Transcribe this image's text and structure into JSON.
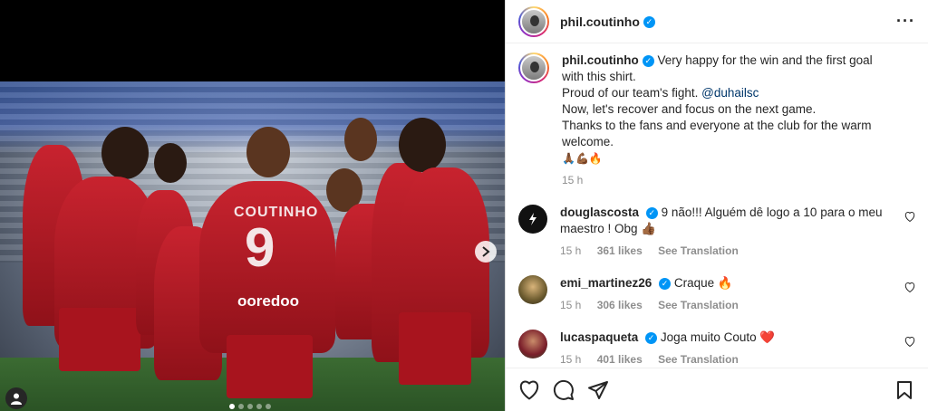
{
  "post": {
    "author": "phil.coutinho",
    "caption_lines": [
      "Very happy for the win and the first goal with this shirt.",
      "Proud of our team's fight.",
      "Now, let's recover and focus on the next game.",
      "Thanks to the fans and everyone at the club for the warm welcome."
    ],
    "mention": "@duhailsc",
    "emojis": "🙏🏾💪🏾🔥",
    "time": "15 h"
  },
  "photo": {
    "jersey_name": "COUTINHO",
    "jersey_number": "9",
    "sponsor": "ooredoo"
  },
  "comments": [
    {
      "user": "douglascosta",
      "text": "9 não!!! Alguém dê logo a 10 para o meu maestro ! Obg 👍🏾",
      "time": "15 h",
      "likes": "361 likes",
      "translate": "See Translation",
      "avatar_color": "#111111"
    },
    {
      "user": "emi_martinez26",
      "text": "Craque 🔥",
      "time": "15 h",
      "likes": "306 likes",
      "translate": "See Translation",
      "avatar_color": "#6b5a2e"
    },
    {
      "user": "lucaspaqueta",
      "text": "Joga muito Couto ❤️",
      "time": "15 h",
      "likes": "401 likes",
      "translate": "See Translation",
      "avatar_color": "#7a1e2a"
    }
  ],
  "carousel": {
    "slides": 5,
    "active": 1
  },
  "icons": [
    "heart-icon",
    "comment-icon",
    "share-icon",
    "save-icon",
    "more-icon",
    "next-arrow-icon",
    "user-tag-icon"
  ]
}
